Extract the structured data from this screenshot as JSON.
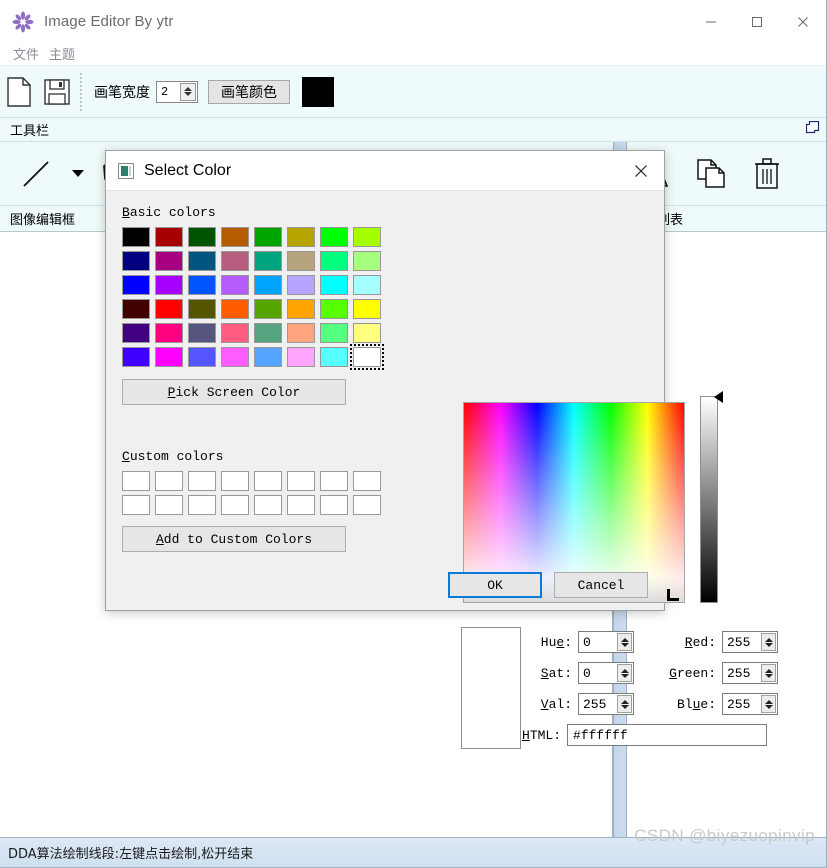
{
  "app": {
    "title": "Image Editor By ytr",
    "icon": "flower-app-icon",
    "window_buttons": [
      {
        "name": "minimize",
        "glyph": "—"
      },
      {
        "name": "maximize",
        "glyph": "□"
      },
      {
        "name": "close",
        "glyph": "✕"
      }
    ],
    "menu": [
      {
        "label": "文件"
      },
      {
        "label": "主题"
      }
    ],
    "toolbar": {
      "new_icon": "new-file-icon",
      "save_icon": "save-floppy-icon",
      "pen_width_label": "画笔宽度",
      "pen_width_value": "2",
      "pen_color_button": "画笔颜色",
      "pen_color_value": "#000000"
    },
    "dock": {
      "header": "工具栏",
      "float_icon": "float-restore-icon"
    },
    "tools": {
      "line_tool_icon": "line-tool-icon",
      "dropdown_icon": "chevron-down-icon",
      "polygon_tool_icon": "polygon-tool-icon",
      "mirror_icon": "mirror-flip-icon",
      "copy_icon": "copy-pages-icon",
      "delete_icon": "trash-delete-icon"
    },
    "panel_caption_left": "图像编辑框",
    "panel_caption_right": "图元列表",
    "statusbar": "DDA算法绘制线段:左键点击绘制,松开结束",
    "watermark": "CSDN @biyezuopinvip"
  },
  "dialog": {
    "title": "Select Color",
    "icon": "color-dialog-icon",
    "close_glyph": "✕",
    "basic_colors_label_accel": "B",
    "basic_colors_label_rest": "asic colors",
    "basic_colors": [
      [
        "#000000",
        "#a60000",
        "#005400",
        "#b65c00",
        "#00a400",
        "#b6a400",
        "#00ff00",
        "#a6ff00"
      ],
      [
        "#000080",
        "#a60080",
        "#00557f",
        "#b65c7f",
        "#00a47f",
        "#b6a47f",
        "#00ff7f",
        "#a6ff7f"
      ],
      [
        "#0000ff",
        "#a600ff",
        "#0055ff",
        "#b65cff",
        "#00a4ff",
        "#b6a4ff",
        "#00ffff",
        "#a6ffff"
      ],
      [
        "#400000",
        "#ff0000",
        "#555400",
        "#ff5c00",
        "#55a400",
        "#ffa400",
        "#55ff00",
        "#ffff00"
      ],
      [
        "#400080",
        "#ff0080",
        "#555580",
        "#ff5c7f",
        "#55a47f",
        "#ffa47f",
        "#55ff7f",
        "#ffff7f"
      ],
      [
        "#4000ff",
        "#ff00ff",
        "#5555ff",
        "#ff5cff",
        "#55a4ff",
        "#ffa4ff",
        "#55ffff",
        "#ffffff"
      ]
    ],
    "selected_basic_index": {
      "row": 5,
      "col": 7
    },
    "pick_screen_color_accel": "P",
    "pick_screen_color_rest": "ick Screen Color",
    "custom_colors_label_accel": "C",
    "custom_colors_label_rest": "ustom colors",
    "custom_colors_rows": 2,
    "custom_colors_cols": 8,
    "add_to_custom_accel": "A",
    "add_to_custom_rest": "dd to Custom Colors",
    "fields": [
      {
        "name": "hue",
        "accel_pre": "Hu",
        "accel": "e",
        "accel_post": ":",
        "value": "0"
      },
      {
        "name": "sat",
        "accel_pre": "",
        "accel": "S",
        "accel_post": "at:",
        "value": "0"
      },
      {
        "name": "val",
        "accel_pre": "",
        "accel": "V",
        "accel_post": "al:",
        "value": "255"
      },
      {
        "name": "red",
        "accel_pre": "",
        "accel": "R",
        "accel_post": "ed:",
        "value": "255"
      },
      {
        "name": "green",
        "accel_pre": "",
        "accel": "G",
        "accel_post": "reen:",
        "value": "255"
      },
      {
        "name": "blue",
        "accel_pre": "Bl",
        "accel": "u",
        "accel_post": "e:",
        "value": "255"
      }
    ],
    "html_label_accel": "H",
    "html_label_rest": "TML:",
    "html_value": "#ffffff",
    "preview_color": "#ffffff",
    "ok_label": "OK",
    "cancel_label": "Cancel",
    "accent_focus_color": "#0b7ad6"
  }
}
